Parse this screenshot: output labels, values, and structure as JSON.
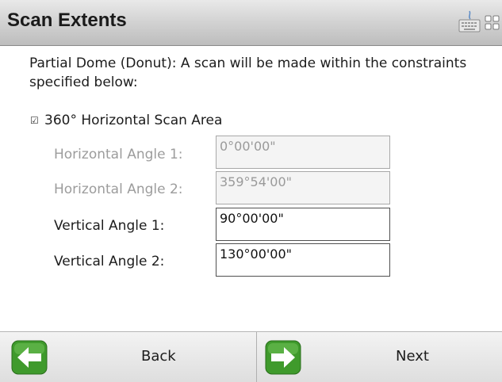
{
  "header": {
    "title": "Scan Extents",
    "icons": [
      "keyboard-icon",
      "grid-icon"
    ]
  },
  "description": "Partial Dome (Donut): A scan will be made within the constraints specified below:",
  "horizontal_scan": {
    "checked": true,
    "label": "360° Horizontal Scan Area"
  },
  "fields": [
    {
      "label": "Horizontal Angle 1:",
      "value": "0°00'00\"",
      "enabled": false
    },
    {
      "label": "Horizontal Angle 2:",
      "value": "359°54'00\"",
      "enabled": false
    },
    {
      "label": "Vertical Angle 1:",
      "value": "90°00'00\"",
      "enabled": true
    },
    {
      "label": "Vertical Angle 2:",
      "value": "130°00'00\"",
      "enabled": true
    }
  ],
  "footer": {
    "back_label": "Back",
    "next_label": "Next",
    "icons": [
      "back-arrow-icon",
      "next-arrow-icon"
    ]
  },
  "colors": {
    "arrow_green": "#3f9a2c",
    "disabled_text": "#9c9c9c"
  }
}
